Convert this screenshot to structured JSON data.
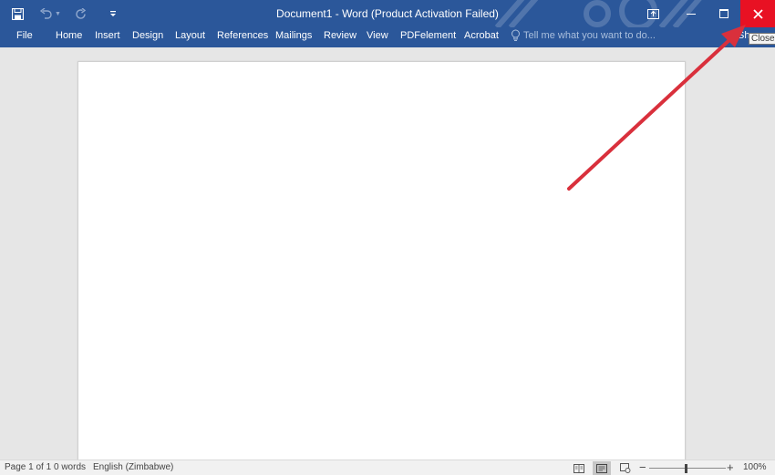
{
  "window": {
    "title": "Document1 - Word (Product Activation Failed)",
    "accent_color": "#2b579a",
    "close_color": "#e81123"
  },
  "quick_access": {
    "save_icon": "save-icon",
    "undo_icon": "undo-icon",
    "redo_icon": "redo-icon",
    "customize_icon": "customize-toolbar-icon"
  },
  "window_controls": {
    "ribbon_display_icon": "ribbon-display-options-icon",
    "minimize_icon": "minimize-icon",
    "maximize_icon": "maximize-icon",
    "close_icon": "close-icon",
    "close_tooltip": "Close"
  },
  "ribbon": {
    "tabs": [
      {
        "label": "File"
      },
      {
        "label": "Home"
      },
      {
        "label": "Insert"
      },
      {
        "label": "Design"
      },
      {
        "label": "Layout"
      },
      {
        "label": "References"
      },
      {
        "label": "Mailings"
      },
      {
        "label": "Review"
      },
      {
        "label": "View"
      },
      {
        "label": "PDFelement"
      },
      {
        "label": "Acrobat"
      }
    ],
    "tell_me": "Tell me what you want to do...",
    "share": "Share"
  },
  "status_bar": {
    "page": "Page 1 of 1",
    "words": "0 words",
    "language": "English (Zimbabwe)",
    "zoom": "100%",
    "zoom_out": "−",
    "zoom_in": "+"
  },
  "annotation": {
    "arrow_color": "#d9303c",
    "target": "close-button"
  }
}
